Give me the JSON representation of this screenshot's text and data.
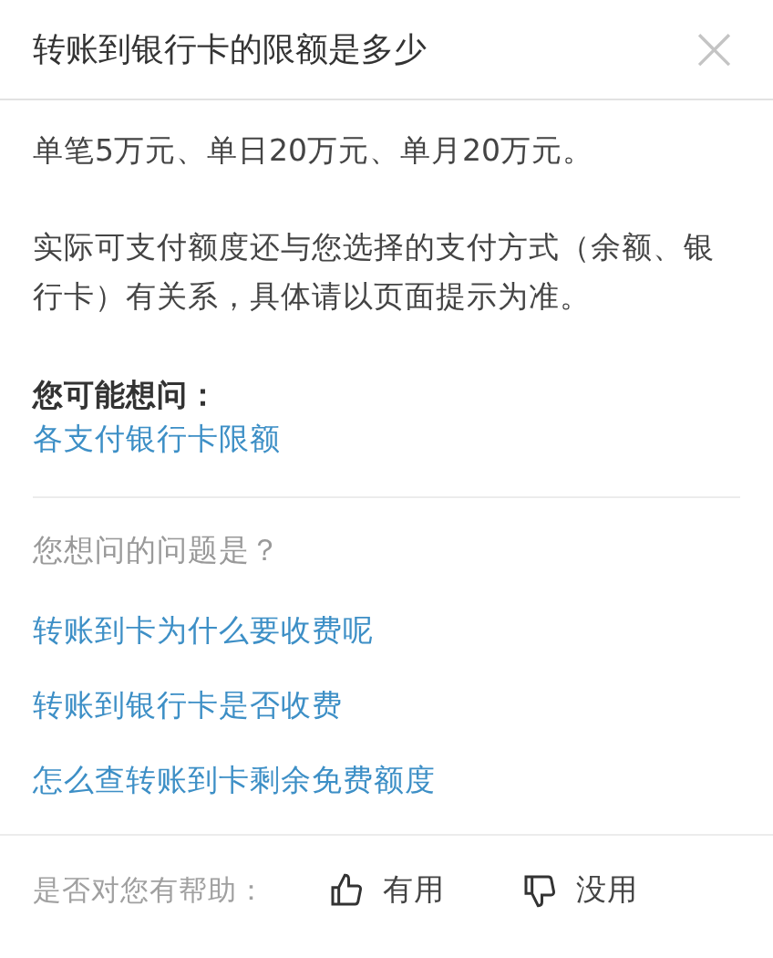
{
  "header": {
    "title": "转账到银行卡的限额是多少",
    "close": "×"
  },
  "answer": [
    "单笔5万元、单日20万元、单月20万元。",
    "实际可支付额度还与您选择的支付方式（余额、银行卡）有关系，具体请以页面提示为准。"
  ],
  "suggest": {
    "title": "您可能想问：",
    "links": [
      "各支付银行卡限额"
    ]
  },
  "questions": {
    "title": "您想问的问题是？",
    "links": [
      "转账到卡为什么要收费呢",
      "转账到银行卡是否收费",
      "怎么查转账到卡剩余免费额度"
    ]
  },
  "feedback": {
    "label": "是否对您有帮助：",
    "buttons": [
      {
        "kind": "up",
        "label": "有用"
      },
      {
        "kind": "down",
        "label": "没用"
      }
    ]
  }
}
